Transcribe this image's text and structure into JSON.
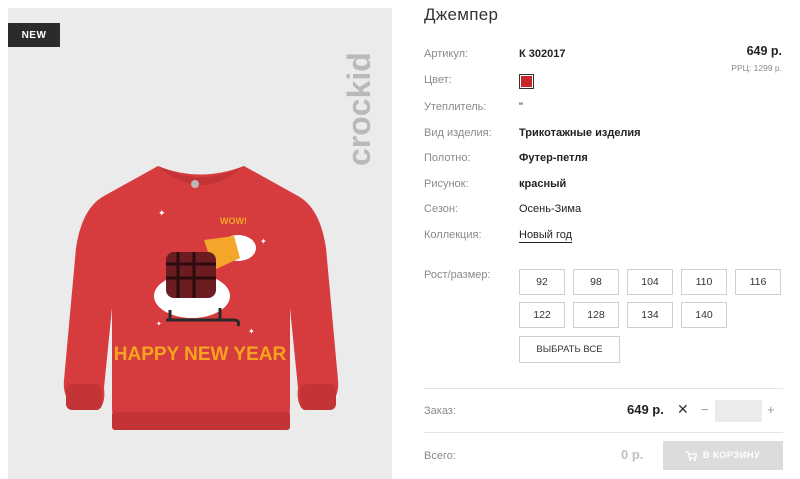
{
  "product": {
    "badge": "NEW",
    "brand": "crockid",
    "print_text": "HAPPY NEW YEAR",
    "bubble_text": "WOW!",
    "title": "Джемпер",
    "price": "649 р.",
    "rrp": "РРЦ: 1299 р.",
    "color_hex": "#c8262a"
  },
  "attributes": [
    {
      "label": "Артикул:",
      "value": "К 302017"
    },
    {
      "label": "Цвет:",
      "value": ""
    },
    {
      "label": "Утеплитель:",
      "value": "\""
    },
    {
      "label": "Вид изделия:",
      "value": "Трикотажные изделия"
    },
    {
      "label": "Полотно:",
      "value": "Футер-петля"
    },
    {
      "label": "Рисунок:",
      "value": "красный"
    },
    {
      "label": "Сезон:",
      "value": "Осень-Зима"
    },
    {
      "label": "Коллекция:",
      "value": "Новый год"
    }
  ],
  "sizes": {
    "label": "Рост/размер:",
    "options": [
      "92",
      "98",
      "104",
      "110",
      "116",
      "122",
      "128",
      "134",
      "140"
    ],
    "select_all": "ВЫБРАТЬ ВСЕ"
  },
  "order": {
    "label": "Заказ:",
    "price": "649 р.",
    "times": "✕",
    "minus": "−",
    "plus": "+",
    "quantity": ""
  },
  "total": {
    "label": "Всего:",
    "value": "0 р.",
    "cart_button": "В КОРЗИНУ"
  },
  "icons": {
    "cart": "cart-icon",
    "remove": "close-icon"
  }
}
